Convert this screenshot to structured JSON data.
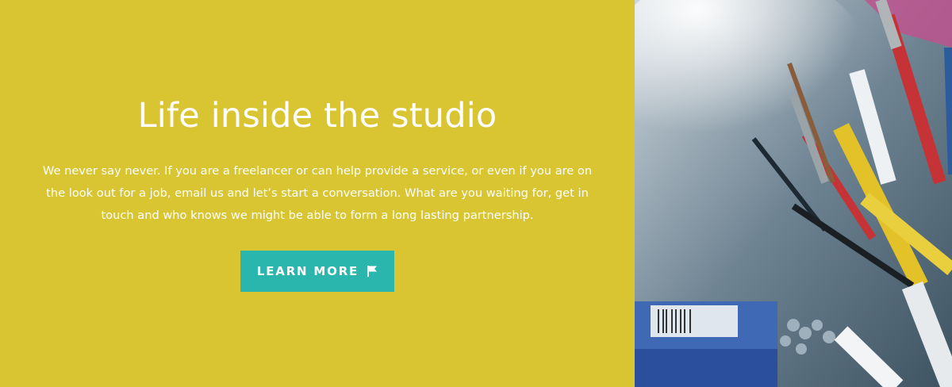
{
  "promo": {
    "title": "Life inside the studio",
    "body": "We never say never. If you are a freelancer or can help provide a service, or even if you are on the look out for a job, email us and let’s start a conversation. What are you waiting for, get in touch and who knows we might be able to form a long lasting partnership.",
    "button_label": "LEARN MORE",
    "button_icon": "flag-icon"
  },
  "colors": {
    "panel_background": "#d9c531",
    "button_background": "#2ab5ad",
    "text": "#ffffff"
  },
  "image": {
    "subject": "pencil-cup-photo"
  }
}
